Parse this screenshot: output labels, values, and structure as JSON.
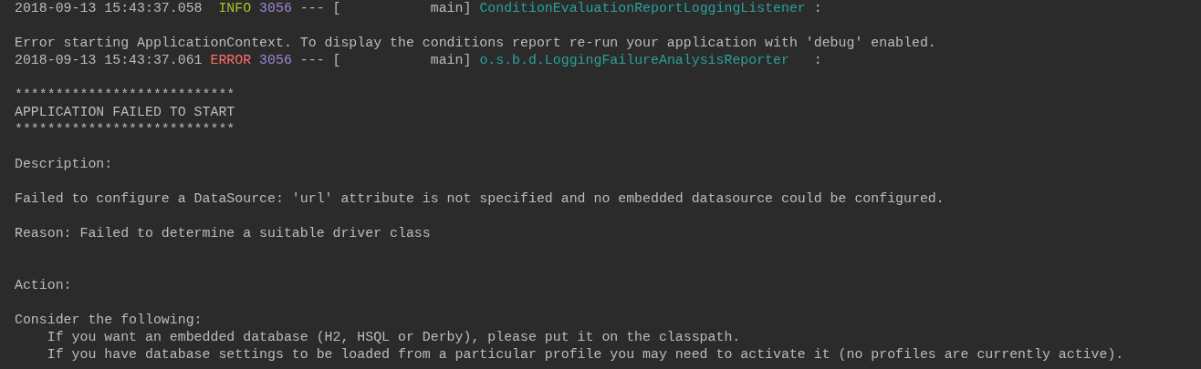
{
  "console": {
    "lines": [
      {
        "kind": "log",
        "segments": [
          {
            "kind": "plain",
            "text": "2018-09-13 15:43:37.058  "
          },
          {
            "kind": "info",
            "text": "INFO "
          },
          {
            "kind": "pid",
            "text": "3056"
          },
          {
            "kind": "plain",
            "text": " --- [           main] "
          },
          {
            "kind": "logger",
            "text": "ConditionEvaluationReportLoggingListener"
          },
          {
            "kind": "plain",
            "text": " :"
          }
        ]
      },
      {
        "kind": "blank"
      },
      {
        "kind": "text",
        "segments": [
          {
            "kind": "plain",
            "text": "Error starting ApplicationContext. To display the conditions report re-run your application with 'debug' enabled."
          }
        ]
      },
      {
        "kind": "log",
        "segments": [
          {
            "kind": "plain",
            "text": "2018-09-13 15:43:37.061 "
          },
          {
            "kind": "error",
            "text": "ERROR "
          },
          {
            "kind": "pid",
            "text": "3056"
          },
          {
            "kind": "plain",
            "text": " --- [           main] "
          },
          {
            "kind": "logger",
            "text": "o.s.b.d.LoggingFailureAnalysisReporter"
          },
          {
            "kind": "plain",
            "text": "   :"
          }
        ]
      },
      {
        "kind": "blank"
      },
      {
        "kind": "text",
        "segments": [
          {
            "kind": "plain",
            "text": "***************************"
          }
        ]
      },
      {
        "kind": "text",
        "segments": [
          {
            "kind": "plain",
            "text": "APPLICATION FAILED TO START"
          }
        ]
      },
      {
        "kind": "text",
        "segments": [
          {
            "kind": "plain",
            "text": "***************************"
          }
        ]
      },
      {
        "kind": "blank"
      },
      {
        "kind": "text",
        "segments": [
          {
            "kind": "plain",
            "text": "Description:"
          }
        ]
      },
      {
        "kind": "blank"
      },
      {
        "kind": "text",
        "segments": [
          {
            "kind": "plain",
            "text": "Failed to configure a DataSource: 'url' attribute is not specified and no embedded datasource could be configured."
          }
        ]
      },
      {
        "kind": "blank"
      },
      {
        "kind": "text",
        "segments": [
          {
            "kind": "plain",
            "text": "Reason: Failed to determine a suitable driver class"
          }
        ]
      },
      {
        "kind": "blank"
      },
      {
        "kind": "blank"
      },
      {
        "kind": "text",
        "segments": [
          {
            "kind": "plain",
            "text": "Action:"
          }
        ]
      },
      {
        "kind": "blank"
      },
      {
        "kind": "text",
        "segments": [
          {
            "kind": "plain",
            "text": "Consider the following:"
          }
        ]
      },
      {
        "kind": "text",
        "segments": [
          {
            "kind": "plain",
            "text": "    If you want an embedded database (H2, HSQL or Derby), please put it on the classpath."
          }
        ]
      },
      {
        "kind": "text",
        "segments": [
          {
            "kind": "plain",
            "text": "    If you have database settings to be loaded from a particular profile you may need to activate it (no profiles are currently active)."
          }
        ]
      }
    ]
  }
}
